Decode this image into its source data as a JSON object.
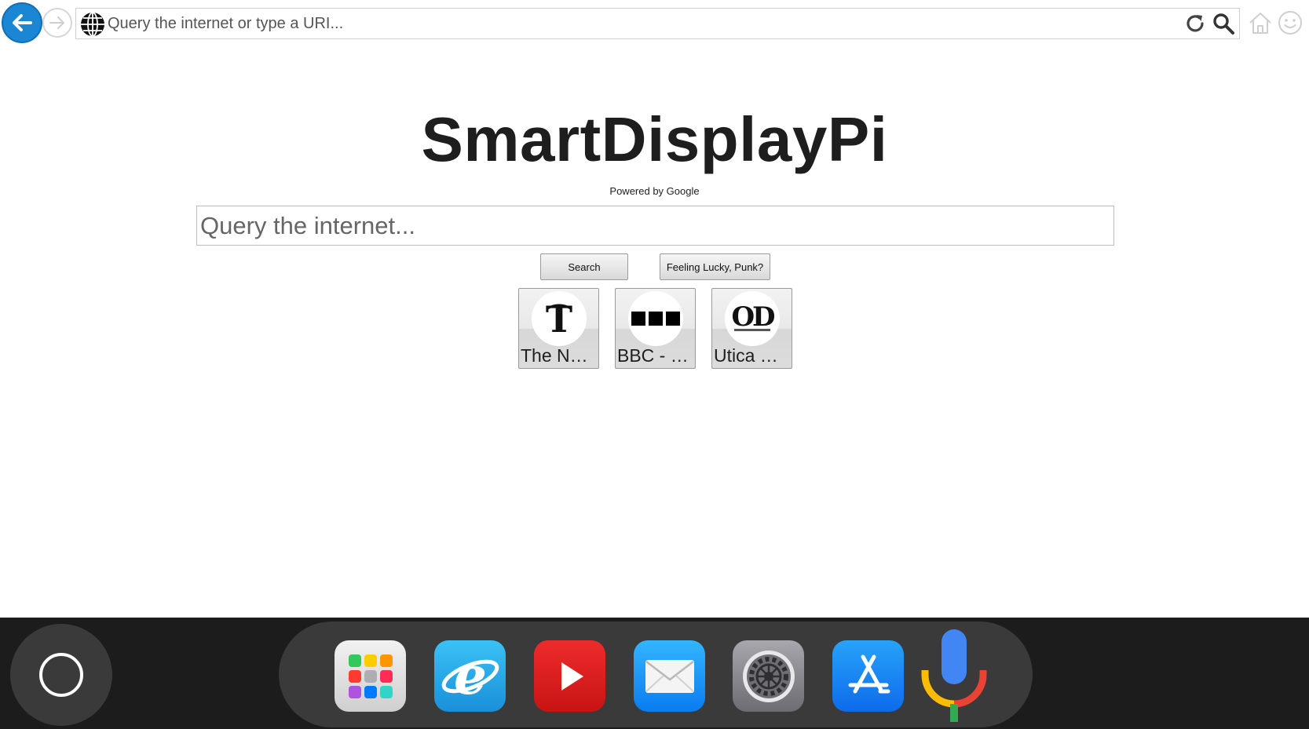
{
  "address_bar": {
    "placeholder": "Query the internet or type a URI..."
  },
  "main": {
    "title": "SmartDisplayPi",
    "powered_by": "Powered by Google",
    "search_placeholder": "Query the internet...",
    "search_button": "Search",
    "lucky_button": "Feeling Lucky, Punk?",
    "shortcuts": [
      {
        "label": "The N…",
        "icon": "nyt-logo-icon"
      },
      {
        "label": "BBC - …",
        "icon": "bbc-logo-icon"
      },
      {
        "label": "Utica …",
        "icon": "od-logo-icon"
      }
    ]
  },
  "dock": {
    "apps": [
      {
        "name": "app-launcher-icon"
      },
      {
        "name": "internet-explorer-icon"
      },
      {
        "name": "youtube-icon"
      },
      {
        "name": "mail-icon"
      },
      {
        "name": "settings-icon"
      },
      {
        "name": "app-store-icon"
      },
      {
        "name": "microphone-icon"
      }
    ]
  },
  "colors": {
    "back_button": "#1b86d4",
    "dock_background": "#1c1c1c",
    "dock_pill": "#3a3a3a"
  }
}
